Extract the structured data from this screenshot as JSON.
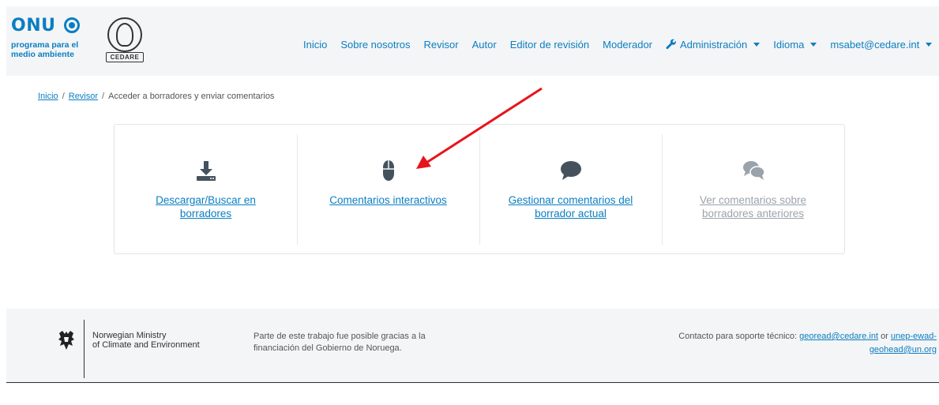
{
  "header": {
    "onu_word": "ONU",
    "onu_sub": [
      "programa para el",
      "medio ambiente"
    ],
    "cedare_label": "CEDARE",
    "nav": [
      {
        "label": "Inicio"
      },
      {
        "label": "Sobre nosotros"
      },
      {
        "label": "Revisor"
      },
      {
        "label": "Autor"
      },
      {
        "label": "Editor de revisión"
      },
      {
        "label": "Moderador"
      },
      {
        "label": "Administración",
        "icon": "wrench-icon",
        "dropdown": true
      },
      {
        "label": "Idioma",
        "dropdown": true
      },
      {
        "label": "msabet@cedare.int",
        "dropdown": true
      }
    ]
  },
  "breadcrumb": {
    "home": "Inicio",
    "reviewer": "Revisor",
    "current": "Acceder a borradores y enviar comentarios",
    "separator": "/"
  },
  "tiles": [
    {
      "icon": "download-icon",
      "label_lines": [
        "Descargar/Buscar en",
        "borradores"
      ]
    },
    {
      "icon": "mouse-icon",
      "label_lines": [
        "Comentarios interactivos"
      ]
    },
    {
      "icon": "comment-icon",
      "label_lines": [
        "Gestionar comentarios del",
        "borrador actual"
      ]
    },
    {
      "icon": "comments-icon",
      "label_lines": [
        "Ver comentarios sobre",
        "borradores anteriores"
      ],
      "muted": true
    }
  ],
  "footer": {
    "ministry": [
      "Norwegian Ministry",
      "of Climate and Environment"
    ],
    "thanks": [
      "Parte de este trabajo fue posible gracias a la",
      "financiación del Gobierno de Noruega."
    ],
    "contact_prefix": "Contacto para soporte técnico:",
    "contact_email1": "georead@cedare.int",
    "contact_or": "or",
    "contact_email2_part1": "unep-ewad-",
    "contact_email2_part2": "geohead@un.org"
  },
  "colors": {
    "link": "#0a7ec2",
    "muted_link": "#9aa3ab",
    "header_bg": "#f4f5f6",
    "icon": "#45525e",
    "arrow": "#e8141b"
  }
}
